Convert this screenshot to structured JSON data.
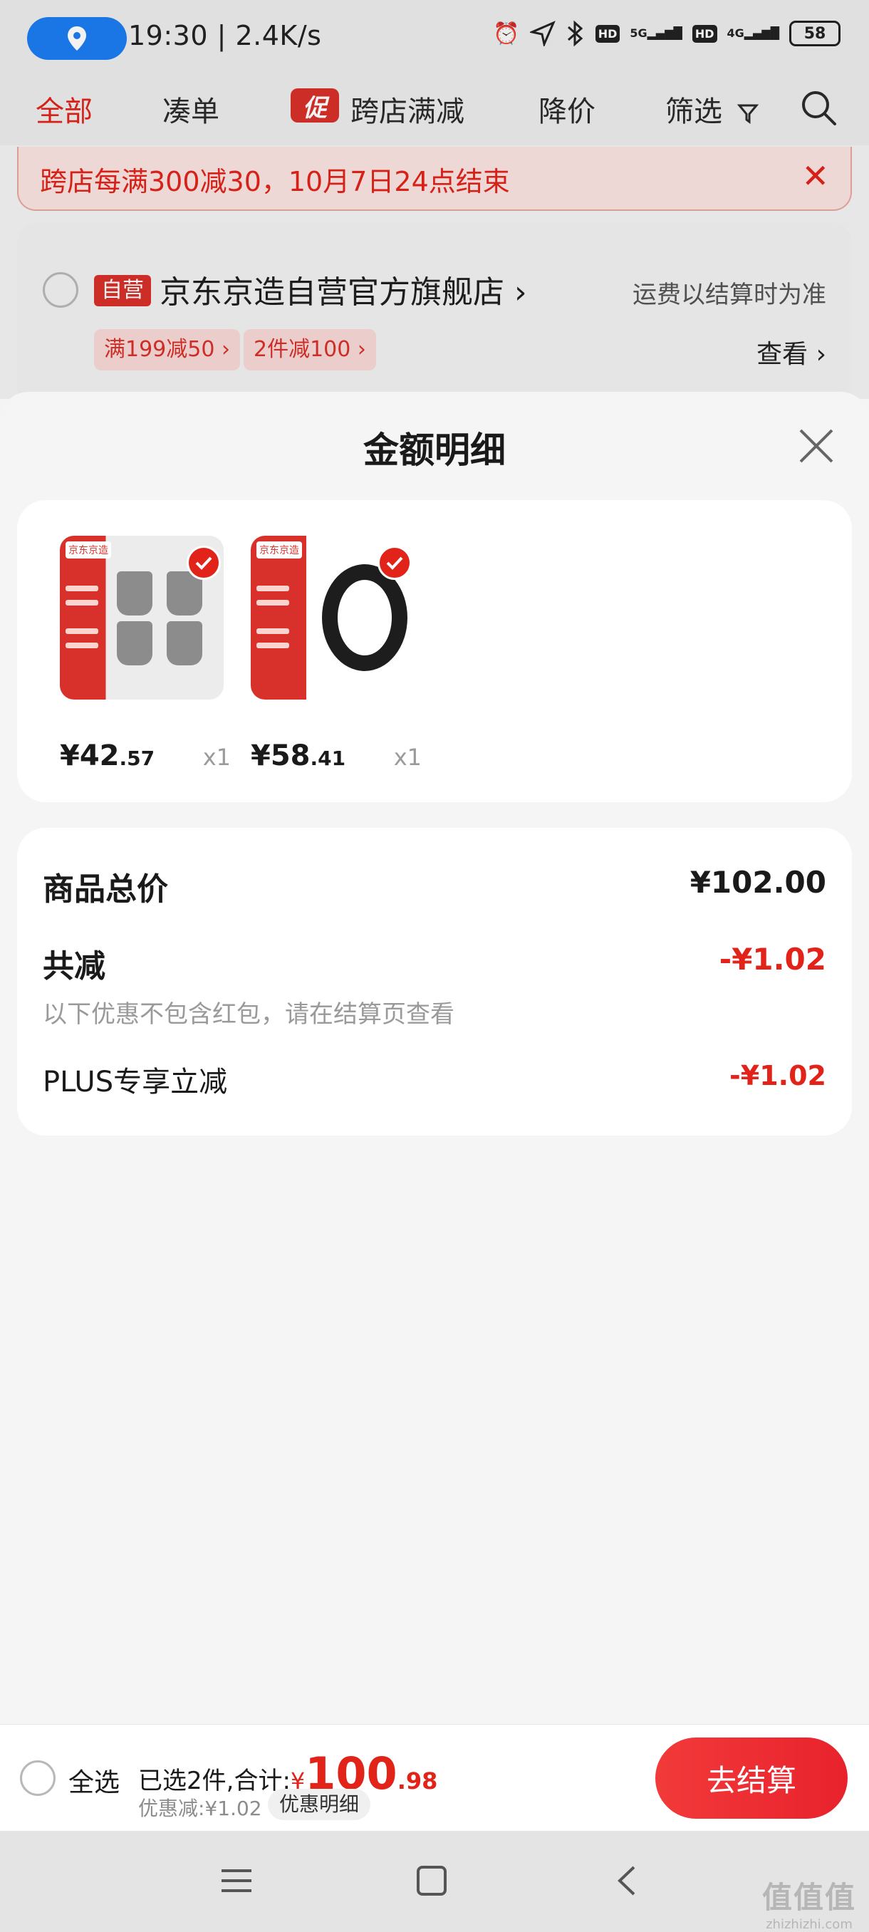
{
  "status_bar": {
    "time_speed": "19:30 | 2.4K/s",
    "signal_5g": "5G",
    "signal_4g": "4G",
    "hd": "HD",
    "battery": "58"
  },
  "tabs": {
    "all": "全部",
    "combine": "凑单",
    "promo_tag": "促",
    "cross_store": "跨店满减",
    "price_drop": "降价",
    "filter": "筛选"
  },
  "notice": {
    "text": "跨店每满300减30，10月7日24点结束"
  },
  "store": {
    "badge": "自营",
    "name": "京东京造自营官方旗舰店 ›",
    "shipping_note": "运费以结算时为准",
    "coupon_1": "满199减50 ›",
    "coupon_2": "2件减100 ›",
    "view_link": "查看 ›"
  },
  "sheet": {
    "title": "金额明细",
    "products": [
      {
        "price_int": "¥42",
        "price_dec": ".57",
        "qty": "x1",
        "thumb_label": "京东京造"
      },
      {
        "price_int": "¥58",
        "price_dec": ".41",
        "qty": "x1",
        "thumb_label": "京东京造"
      }
    ],
    "summary": {
      "total_label": "商品总价",
      "total_value": "¥102.00",
      "discount_label": "共减",
      "discount_value": "-¥1.02",
      "discount_note": "以下优惠不包含红包，请在结算页查看",
      "plus_label": "PLUS专享立减",
      "plus_value": "-¥1.02"
    }
  },
  "checkout": {
    "select_all": "全选",
    "selected_prefix": "已选2件,合计:",
    "total_symbol": "¥",
    "total_int": "100",
    "total_dec": ".98",
    "discount_text": "优惠减:¥1.02",
    "discount_detail_btn": "优惠明细",
    "checkout_btn": "去结算"
  },
  "watermark": {
    "big": "值值值",
    "small": "zhizhizhi.com"
  },
  "colors": {
    "accent": "#e2231a",
    "background": "#f4f4f4"
  }
}
